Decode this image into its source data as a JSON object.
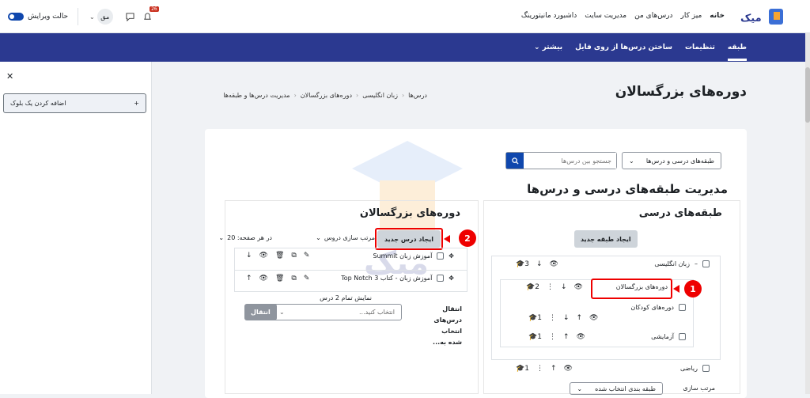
{
  "topnav": {
    "items": [
      "خانه",
      "میز کار",
      "درس‌های من",
      "مدیریت سایت",
      "داشبورد مانیتورینگ"
    ],
    "edit_mode": "حالت ویرایش",
    "user_initials": "مق",
    "notif_count": "26"
  },
  "secnav": {
    "items": [
      "طبقه",
      "تنظیمات",
      "ساختن درس‌ها از روی فایل",
      "بیشتر"
    ]
  },
  "drawer": {
    "add_block": "اضافه کردن یک بلوک"
  },
  "breadcrumb": [
    "درس‌ها",
    "زبان انگلیسی",
    "دوره‌های بزرگسالان",
    "مدیریت درس‌ها و طبقه‌ها"
  ],
  "page_title": "دوره‌های بزرگسالان",
  "filter": {
    "select": "طبقه‌های درسی و درس‌ها",
    "search_placeholder": "جستجو بین درس‌ها"
  },
  "manage_title": "مدیریت طبقه‌های درسی و درس‌ها",
  "categories": {
    "heading": "طبقه‌های درسی",
    "create_btn": "ایجاد طبقه جدید",
    "rows": [
      {
        "name": "زبان انگلیسی",
        "count": "3"
      },
      {
        "name": "دوره‌های بزرگسالان",
        "count": "2"
      },
      {
        "name": "دوره‌های کودکان",
        "count": "1"
      },
      {
        "name": "آزمایشی",
        "count": "1"
      },
      {
        "name": "ریاضی",
        "count": "1"
      }
    ],
    "sort_label": "مرتب سازی",
    "sort_select": "طبقه بندی انتخاب شده"
  },
  "courses": {
    "heading": "دوره‌های بزرگسالان",
    "create_btn": "ایجاد درس جدید",
    "sort": "مرتب سازی دروس",
    "per_page": "در هر صفحه: 20",
    "rows": [
      "آموزش زبان Summit",
      "آموزش زبان - کتاب Top Notch 3"
    ],
    "showing": "نمایش تمام 2 درس",
    "move_label": "انتقال درس‌های انتخاب شده به...",
    "move_placeholder": "انتخاب کنید...",
    "move_btn": "انتقال"
  },
  "annotations": [
    "1",
    "2"
  ],
  "colors": {
    "primary": "#0f47ad",
    "navbar": "#2b3990",
    "highlight": "#e00000"
  }
}
